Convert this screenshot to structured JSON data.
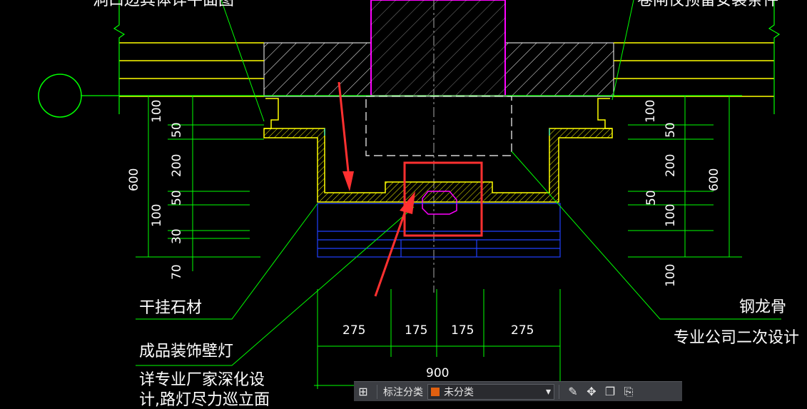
{
  "labels": {
    "top_left_note": "洞口边其体详平面图",
    "top_right_note": "卷闸仪预留安装条件",
    "dry_hang_stone": "干挂石材",
    "wall_lamp": "成品装饰壁灯",
    "factory_detail_1": "详专业厂家深化设",
    "factory_detail_2": "计,路灯尽力巡立面",
    "steel_keel": "钢龙骨",
    "secondary_design": "专业公司二次设计"
  },
  "dims": {
    "left": [
      "100",
      "50",
      "200",
      "50",
      "100",
      "30",
      "70"
    ],
    "left_total": "600",
    "right": [
      "100",
      "50",
      "200",
      "50",
      "100",
      "100"
    ],
    "right_total": "600",
    "bottom": [
      "275",
      "175",
      "175",
      "275"
    ],
    "bottom_total": "900"
  },
  "toolbar": {
    "category_label": "标注分类",
    "category_value": "未分类",
    "category_color": "#e06010",
    "icons": [
      "layout-icon",
      "edit-icon",
      "move-icon",
      "copy-icon",
      "paste-icon"
    ]
  },
  "colors": {
    "green": "#00ff00",
    "yellow": "#ffff00",
    "magenta": "#ff00ff",
    "blue": "#2040ff",
    "cyan": "#00ffff",
    "red": "#ff3030",
    "white": "#ffffff"
  }
}
